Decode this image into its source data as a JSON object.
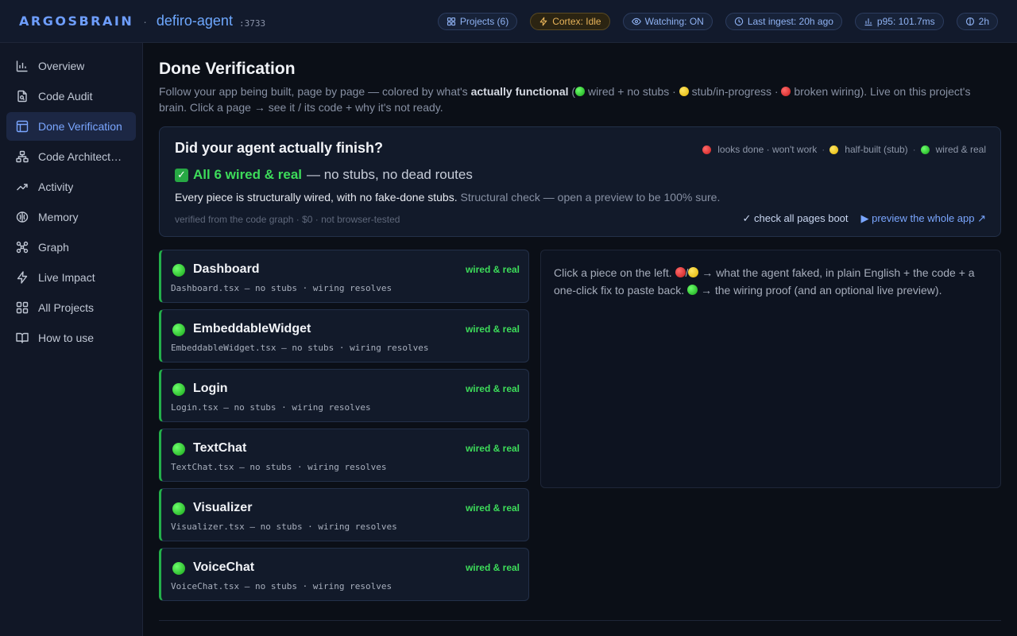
{
  "topbar": {
    "brand": "ARGOSBRAIN",
    "separator": "·",
    "project": "defiro-agent",
    "port": ":3733",
    "pills": {
      "projects": "Projects (6)",
      "cortex": "Cortex: Idle",
      "watching": "Watching: ON",
      "ingest": "Last ingest: 20h ago",
      "p95": "p95: 101.7ms",
      "uptime": "2h"
    }
  },
  "sidebar": {
    "items": [
      {
        "label": "Overview"
      },
      {
        "label": "Code Audit"
      },
      {
        "label": "Done Verification"
      },
      {
        "label": "Code Architecture"
      },
      {
        "label": "Activity"
      },
      {
        "label": "Memory"
      },
      {
        "label": "Graph"
      },
      {
        "label": "Live Impact"
      },
      {
        "label": "All Projects"
      },
      {
        "label": "How to use"
      }
    ]
  },
  "main": {
    "title": "Done Verification",
    "desc": {
      "p1": "Follow your app being built, page by page — colored by what's ",
      "strong": "actually functional",
      "p2": " (",
      "p3": " wired + no stubs · ",
      "p4": " stub/in-progress · ",
      "p5": " broken wiring). Live on this project's brain. Click a page → see it / its code + why it's not ready."
    },
    "summary": {
      "question": "Did your agent actually finish?",
      "legend": {
        "broken": "looks done · won't work",
        "stub": "half-built (stub)",
        "wired": "wired & real",
        "sep": "·"
      },
      "status_check": "✓",
      "status_strong": "All 6 wired & real",
      "status_rest": "— no stubs, no dead routes",
      "note": "Every piece is structurally wired, with no fake-done stubs.",
      "note_muted": "Structural check — open a preview to be 100% sure.",
      "footer": "verified from the code graph · $0 · not browser-tested",
      "link_check": "✓ check all pages boot",
      "link_preview": "▶ preview the whole app ↗"
    },
    "pages": [
      {
        "name": "Dashboard",
        "badge": "wired & real",
        "sub": "Dashboard.tsx — no stubs · wiring resolves"
      },
      {
        "name": "EmbeddableWidget",
        "badge": "wired & real",
        "sub": "EmbeddableWidget.tsx — no stubs · wiring resolves"
      },
      {
        "name": "Login",
        "badge": "wired & real",
        "sub": "Login.tsx — no stubs · wiring resolves"
      },
      {
        "name": "TextChat",
        "badge": "wired & real",
        "sub": "TextChat.tsx — no stubs · wiring resolves"
      },
      {
        "name": "Visualizer",
        "badge": "wired & real",
        "sub": "Visualizer.tsx — no stubs · wiring resolves"
      },
      {
        "name": "VoiceChat",
        "badge": "wired & real",
        "sub": "VoiceChat.tsx — no stubs · wiring resolves"
      }
    ],
    "detail": {
      "t1": "Click a piece on the left. ",
      "slash": "/",
      "t2": " → what the agent faked, in plain English + the code + a one-click fix to paste back. ",
      "t3": " → the wiring proof (and an optional live preview)."
    }
  },
  "colors": {
    "accent": "#6ea8ff",
    "wired": "#3ddc5a",
    "stub": "#f5c400",
    "broken": "#e53535",
    "background": "#0b0f17"
  }
}
